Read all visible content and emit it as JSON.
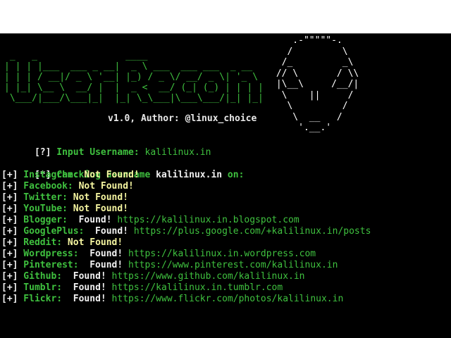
{
  "banner": {
    "ascii_lines": [
      "                                    ",
      " _   _                ____                          ",
      "| | | |___  ___ _ __|  _ \\ ___  ___ ___  _ __  ",
      "| | | / __|/ _ \\ '__| |_) / _ \\/ __/ _ \\| '_ \\ ",
      "| |_| \\__ \\  __/ |  |  _ <  __/ (_| (_) | | | |",
      " \\___/|___/\\___|_|  |_| \\_\\___|\\___\\___/|_| |_|"
    ],
    "alien_lines": [
      "    .-\"\"\"\"\"-.",
      "   /         \\",
      "  /_         _\\",
      " // \\       / \\\\",
      " |\\__\\     /__/|",
      "  \\    ||     /",
      "   \\         /",
      "    \\  __   /",
      "     '.__.'"
    ],
    "version_text": "v1.0, Author: @linux_choice"
  },
  "input_prompt": {
    "prefix": "[?]",
    "label": " Input Username: ",
    "value": "kalilinux.in"
  },
  "checking": {
    "prefix": "[*]",
    "text_before": " Checking username ",
    "username": "kalilinux.in",
    "text_after": " on:"
  },
  "results": [
    {
      "prefix": "[+]",
      "site": " Instagram:",
      "status": " Not Found!",
      "url": ""
    },
    {
      "prefix": "[+]",
      "site": " Facebook:",
      "status": " Not Found!",
      "url": ""
    },
    {
      "prefix": "[+]",
      "site": " Twitter:",
      "status": " Not Found!",
      "url": ""
    },
    {
      "prefix": "[+]",
      "site": " YouTube:",
      "status": " Not Found!",
      "url": ""
    },
    {
      "prefix": "[+]",
      "site": " Blogger:",
      "status": "  Found!",
      "url": " https://kalilinux.in.blogspot.com"
    },
    {
      "prefix": "[+]",
      "site": " GooglePlus:",
      "status": "  Found!",
      "url": " https://plus.google.com/+kalilinux.in/posts"
    },
    {
      "prefix": "[+]",
      "site": " Reddit:",
      "status": " Not Found!",
      "url": ""
    },
    {
      "prefix": "[+]",
      "site": " Wordpress:",
      "status": "  Found!",
      "url": " https://kalilinux.in.wordpress.com"
    },
    {
      "prefix": "[+]",
      "site": " Pinterest:",
      "status": "  Found!",
      "url": " https://www.pinterest.com/kalilinux.in"
    },
    {
      "prefix": "[+]",
      "site": " Github:",
      "status": "  Found!",
      "url": " https://www.github.com/kalilinux.in"
    },
    {
      "prefix": "[+]",
      "site": " Tumblr:",
      "status": "  Found!",
      "url": " https://kalilinux.in.tumblr.com"
    },
    {
      "prefix": "[+]",
      "site": " Flickr:",
      "status": "  Found!",
      "url": " https://www.flickr.com/photos/kalilinux.in"
    }
  ],
  "colors": {
    "background": "#000000",
    "green": "#3fc13f",
    "white": "#f0f0f0",
    "not_found": "#f5f5a0",
    "top_bar": "#ffffff"
  }
}
